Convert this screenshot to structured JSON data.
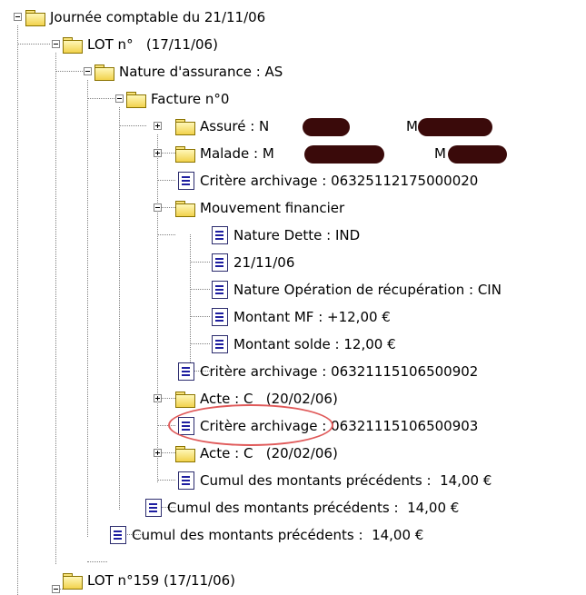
{
  "tree": {
    "journee": "Journée comptable du 21/11/06",
    "lot1": "LOT n°   (17/11/06)",
    "nature_assurance": "Nature d'assurance : AS",
    "facture": "Facture n°0",
    "assure_label": "Assuré : N",
    "assure_m": "M",
    "malade_label": "Malade : M",
    "malade_m": "M",
    "critere1": "Critère archivage : 06325112175000020",
    "mouvement": "Mouvement financier",
    "nature_dette": "Nature Dette : IND",
    "date": "21/11/06",
    "nature_operation": "Nature Opération de récupération : CIN",
    "montant_mf": "Montant MF : +12,00 €",
    "montant_solde": "Montant solde : 12,00 €",
    "critere2": "Critère archivage : 06321115106500902",
    "acte1": "Acte : C   (20/02/06)",
    "critere3": "Critère archivage : 06321115106500903",
    "acte2": "Acte : C   (20/02/06)",
    "cumul1": "Cumul des montants précédents :  14,00 €",
    "cumul2": "Cumul des montants précédents :  14,00 €",
    "cumul3": "Cumul des montants précédents :  14,00 €",
    "lot2": "LOT n°159 (17/11/06)"
  },
  "colors": {
    "highlight_circle": "#e05a5a",
    "redaction": "#3a0a0a",
    "folder": "#f2d24c"
  }
}
